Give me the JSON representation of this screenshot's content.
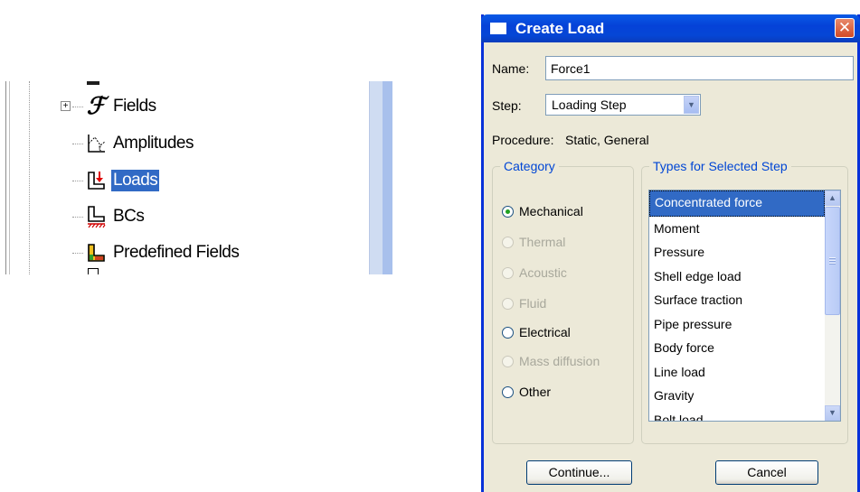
{
  "tree": {
    "items": [
      {
        "label": "Fields",
        "icon": "fields-icon",
        "selected": false,
        "expander": "+"
      },
      {
        "label": "Amplitudes",
        "icon": "amplitudes-icon",
        "selected": false
      },
      {
        "label": "Loads",
        "icon": "loads-icon",
        "selected": true
      },
      {
        "label": "BCs",
        "icon": "bcs-icon",
        "selected": false
      },
      {
        "label": "Predefined Fields",
        "icon": "predefined-fields-icon",
        "selected": false
      }
    ]
  },
  "dialog": {
    "title": "Create Load",
    "close_glyph": "✕",
    "name_label": "Name:",
    "name_value": "Force1",
    "step_label": "Step:",
    "step_value": "Loading Step",
    "procedure_label": "Procedure:",
    "procedure_value": "Static, General",
    "category": {
      "legend": "Category",
      "options": [
        {
          "label": "Mechanical",
          "checked": true,
          "enabled": true
        },
        {
          "label": "Thermal",
          "checked": false,
          "enabled": false
        },
        {
          "label": "Acoustic",
          "checked": false,
          "enabled": false
        },
        {
          "label": "Fluid",
          "checked": false,
          "enabled": false
        },
        {
          "label": "Electrical",
          "checked": false,
          "enabled": true
        },
        {
          "label": "Mass diffusion",
          "checked": false,
          "enabled": false
        },
        {
          "label": "Other",
          "checked": false,
          "enabled": true
        }
      ]
    },
    "types": {
      "legend": "Types for Selected Step",
      "items": [
        "Concentrated force",
        "Moment",
        "Pressure",
        "Shell edge load",
        "Surface traction",
        "Pipe pressure",
        "Body force",
        "Line load",
        "Gravity",
        "Bolt load"
      ],
      "selected_index": 0
    },
    "buttons": {
      "continue": "Continue...",
      "cancel": "Cancel"
    }
  },
  "colors": {
    "selection": "#316ac5",
    "titlebar": "#0542d8",
    "legend_text": "#0046d5",
    "dialog_bg": "#ece9d8"
  }
}
